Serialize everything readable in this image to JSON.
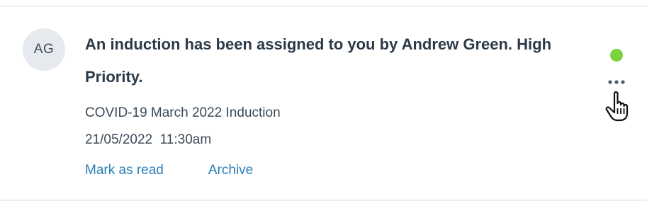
{
  "notification": {
    "avatar_initials": "AG",
    "message": "An induction has been assigned to you by Andrew Green. High Priority.",
    "course": "COVID-19 March 2022 Induction",
    "timestamp": "21/05/2022  11:30am",
    "actions": {
      "mark_as_read": "Mark as read",
      "archive": "Archive"
    },
    "unread": true,
    "icons": {
      "more": "more-horizontal-icon",
      "cursor": "hand-pointer-icon"
    },
    "colors": {
      "link": "#2a7fb8",
      "unread_dot": "#7ad33c",
      "avatar_bg": "#e6eaee",
      "text": "#2b3a48"
    }
  }
}
